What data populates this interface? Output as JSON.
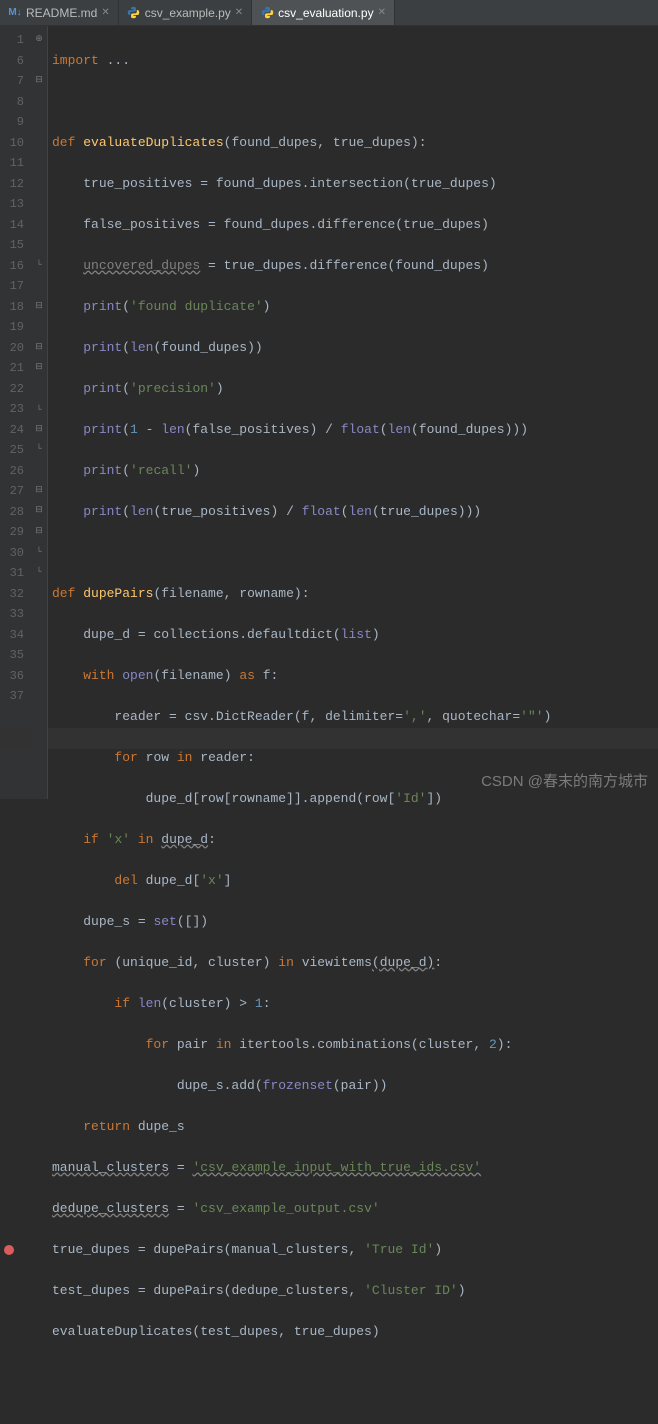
{
  "tabs": [
    {
      "name": "README.md",
      "icon": "md"
    },
    {
      "name": "csv_example.py",
      "icon": "py"
    },
    {
      "name": "csv_evaluation.py",
      "icon": "py",
      "active": true
    }
  ],
  "gutter_lines": [
    "1",
    "6",
    "7",
    "8",
    "9",
    "10",
    "11",
    "12",
    "13",
    "14",
    "15",
    "16",
    "17",
    "18",
    "19",
    "20",
    "21",
    "22",
    "23",
    "24",
    "25",
    "26",
    "27",
    "28",
    "29",
    "30",
    "31",
    "32",
    "33",
    "34",
    "35",
    "36",
    "37"
  ],
  "code": {
    "l1": {
      "kw_import": "import",
      "rest": " ..."
    },
    "l7": {
      "kw_def": "def",
      "fn": "evaluateDuplicates",
      "p1": "found_dupes",
      "p2": "true_dupes"
    },
    "l8": {
      "lhs": "true_positives",
      "eq": " = ",
      "rhs": "found_dupes.intersection(true_dupes)"
    },
    "l9": {
      "lhs": "false_positives",
      "eq": " = ",
      "rhs": "found_dupes.difference(true_dupes)"
    },
    "l10": {
      "lhs": "uncovered_dupes",
      "eq": " = ",
      "rhs": "true_dupes.difference(found_dupes)"
    },
    "l11": {
      "fn": "print",
      "str": "'found duplicate'"
    },
    "l12": {
      "fn": "print",
      "inner_fn": "len",
      "arg": "found_dupes"
    },
    "l13": {
      "fn": "print",
      "str": "'precision'"
    },
    "l14": {
      "fn": "print",
      "num": "1",
      "minus": " - ",
      "len": "len",
      "arg1": "false_positives",
      "div": " / ",
      "float": "float",
      "arg2": "found_dupes"
    },
    "l15": {
      "fn": "print",
      "str": "'recall'"
    },
    "l16": {
      "fn": "print",
      "len": "len",
      "arg1": "true_positives",
      "div": " / ",
      "float": "float",
      "arg2": "true_dupes"
    },
    "l18": {
      "kw_def": "def",
      "fn": "dupePairs",
      "p1": "filename",
      "p2": "rowname"
    },
    "l19": {
      "lhs": "dupe_d",
      "eq": " = ",
      "rhs1": "collections.defaultdict(",
      "builtin": "list",
      "rhs2": ")"
    },
    "l20": {
      "kw_with": "with",
      "open": "open",
      "arg": "filename",
      "kw_as": "as",
      "var": "f"
    },
    "l21": {
      "lhs": "reader",
      "eq": " = ",
      "rhs": "csv.DictReader(f",
      "kw1": "delimiter",
      "s1": "','",
      "kw2": "quotechar",
      "s2": "'\"'"
    },
    "l22": {
      "kw_for": "for",
      "var": "row",
      "kw_in": "in",
      "iter": "reader"
    },
    "l23": {
      "call": "dupe_d[row[rowname]].append(row[",
      "str": "'Id'",
      "end": "])"
    },
    "l24": {
      "kw_if": "if",
      "str": "'x'",
      "kw_in": "in",
      "obj": "dupe_d"
    },
    "l25": {
      "kw_del": "del",
      "obj": "dupe_d[",
      "str": "'x'",
      "end": "]"
    },
    "l26": {
      "lhs": "dupe_s",
      "eq": " = ",
      "set": "set",
      "arg": "([])"
    },
    "l27": {
      "kw_for": "for",
      "vars": "(unique_id, cluster)",
      "kw_in": "in",
      "fn": "viewitems",
      "arg": "(dupe_d)"
    },
    "l28": {
      "kw_if": "if",
      "len": "len",
      "arg": "(cluster)",
      "gt": " > ",
      "num": "1"
    },
    "l29": {
      "kw_for": "for",
      "var": "pair",
      "kw_in": "in",
      "call": "itertools.combinations(cluster, ",
      "num": "2",
      "end": ")"
    },
    "l30": {
      "call": "dupe_s.add(",
      "fn": "frozenset",
      "arg": "(pair))"
    },
    "l31": {
      "kw_return": "return",
      "val": "dupe_s"
    },
    "l32": {
      "lhs": "manual_clusters",
      "eq": " = ",
      "str": "'csv_example_input_with_true_ids.csv'"
    },
    "l33": {
      "lhs": "dedupe_clusters",
      "eq": " = ",
      "str": "'csv_example_output.csv'"
    },
    "l34": {
      "lhs": "true_dupes",
      "eq": " = ",
      "fn": "dupePairs",
      "arg1": "manual_clusters",
      "str": "'True Id'"
    },
    "l35": {
      "lhs": "test_dupes",
      "eq": " = ",
      "fn": "dupePairs",
      "arg1": "dedupe_clusters",
      "str": "'Cluster ID'"
    },
    "l36": {
      "call": "evaluateDuplicates(test_dupes, true_dupes)"
    }
  },
  "watermark": "CSDN @春末的南方城市"
}
